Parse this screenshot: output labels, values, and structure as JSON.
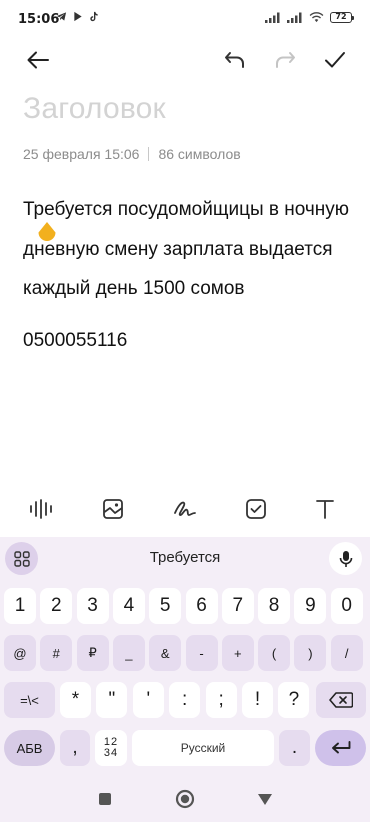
{
  "status_bar": {
    "time": "15:06",
    "battery": "72",
    "left_icons": [
      "telegram-icon",
      "play-icon",
      "tiktok-icon"
    ],
    "right_icons": [
      "signal-icon",
      "signal-icon",
      "wifi-icon",
      "battery-icon"
    ]
  },
  "toolbar": {
    "back_icon": "arrow-left-icon",
    "undo_icon": "undo-icon",
    "redo_icon": "redo-icon",
    "done_icon": "check-icon"
  },
  "note": {
    "title_placeholder": "Заголовок",
    "date": "25 февраля 15:06",
    "char_count": "86 символов",
    "body_paragraph": "Требуется посудомойщицы в ночную дневную смену зарплата выдается каждый день 1500 сомов",
    "phone": "0500055116"
  },
  "format_toolbar": [
    "audio-wave-icon",
    "image-icon",
    "handwriting-icon",
    "checkbox-icon",
    "text-format-icon"
  ],
  "keyboard": {
    "suggestion": "Требуется",
    "row1": [
      "1",
      "2",
      "3",
      "4",
      "5",
      "6",
      "7",
      "8",
      "9",
      "0"
    ],
    "row2": [
      "@",
      "#",
      "₽",
      "_",
      "&",
      "-",
      "+",
      "(",
      ")",
      "/"
    ],
    "row3_shift": "=\\<",
    "row3": [
      "*",
      "\"",
      "'",
      ":",
      ";",
      "!",
      "?"
    ],
    "lang_key": "АБВ",
    "comma": ",",
    "nums_key_top": "12",
    "nums_key_bottom": "34",
    "space_label": "Русский",
    "period": "."
  },
  "nav_bar": [
    "square-icon",
    "circle-icon",
    "triangle-icon"
  ],
  "colors": {
    "keyboard_bg": "#f4eef7",
    "fn_key": "#e6dcef",
    "enter_key": "#cfc1ea",
    "cursor_handle": "#f2b01e"
  }
}
